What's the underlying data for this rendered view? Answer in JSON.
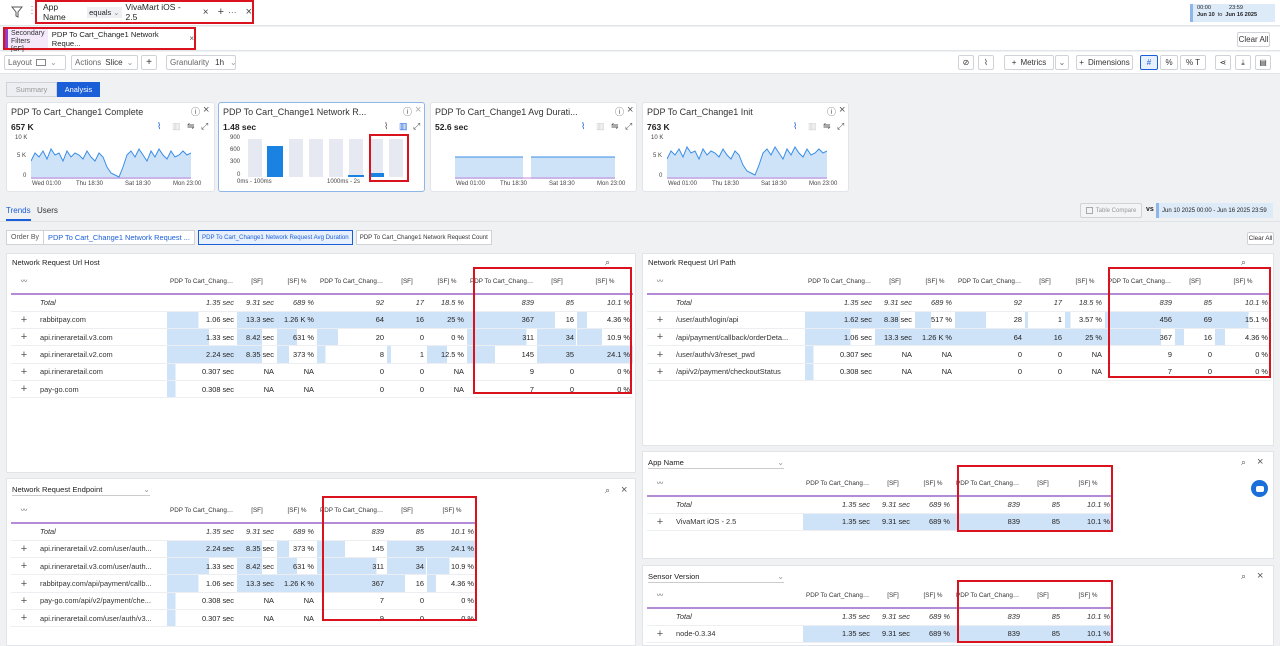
{
  "filterbar": {
    "field": "App Name",
    "operator": "equals",
    "value": "VivaMart iOS - 2.5",
    "date_from_time": "00:00",
    "date_from": "Jun 10",
    "date_to_time": "23:59",
    "date_to_label": "to",
    "date_to": "Jun 16 2025"
  },
  "secondary": {
    "label": "Secondary Filters [SF]",
    "chip": "PDP To Cart_Change1 Network Reque...",
    "clear_all": "Clear All"
  },
  "toolbar": {
    "layout": "Layout",
    "actions": "Actions",
    "slice": "Slice",
    "granularity": "Granularity",
    "granularity_value": "1h",
    "metrics": "Metrics",
    "dimensions": "Dimensions",
    "fmt_number": "#",
    "fmt_percent": "%",
    "fmt_pct_total": "% T"
  },
  "view_tabs": {
    "summary": "Summary",
    "analysis": "Analysis"
  },
  "cards": [
    {
      "title": "PDP To Cart_Change1 Complete",
      "value": "657 K",
      "y_top": "10 K",
      "y_mid": "5 K",
      "y_bot": "0",
      "x": [
        "Wed 01:00",
        "Thu 18:30",
        "Sat 18:30",
        "Mon 23:00"
      ]
    },
    {
      "title": "PDP To Cart_Change1 Network R...",
      "value": "1.48 sec",
      "y_top": "900",
      "y_mid1": "600",
      "y_mid2": "300",
      "y_bot": "0",
      "x": [
        "0ms - 100ms",
        "1000ms - 2s",
        "..."
      ]
    },
    {
      "title": "PDP To Cart_Change1 Avg Durati...",
      "value": "52.6 sec",
      "x": [
        "Wed 01:00",
        "Thu 18:30",
        "Sat 18:30",
        "Mon 23:00"
      ]
    },
    {
      "title": "PDP To Cart_Change1 Init",
      "value": "763 K",
      "y_top": "10 K",
      "y_mid": "5 K",
      "y_bot": "0",
      "x": [
        "Wed 01:00",
        "Thu 18:30",
        "Sat 18:30",
        "Mon 23:00"
      ]
    }
  ],
  "subtabs": {
    "trends": "Trends",
    "users": "Users"
  },
  "compare": {
    "table_compare": "Table Compare",
    "vs": "vs",
    "range": "Jun 10 2025 00:00 - Jun 16 2025 23:59"
  },
  "orderby": {
    "label": "Order By",
    "value": "PDP To Cart_Change1 Network Request ...",
    "chip1": "PDP To Cart_Change1 Network Request Avg Duration",
    "chip2": "PDP To Cart_Change1 Network Request Count",
    "clear_all": "Clear All"
  },
  "headers": {
    "avg": "PDP To Cart_Change1 Network Request Avg Duration",
    "sf": "[SF]",
    "sfp": "[SF] %",
    "fail": "PDP To Cart_Change1 Network Request Failure",
    "count": "PDP To Cart_Change1 Network Request Count"
  },
  "host": {
    "title": "Network Request Url Host",
    "rows": [
      {
        "name": "Total",
        "avg": "1.35 sec",
        "sf": "9.31 sec",
        "sfp": "689 %",
        "fail": "92",
        "fsf": "17",
        "fsfp": "18.5 %",
        "cnt": "839",
        "csf": "85",
        "csfp": "10.1 %"
      },
      {
        "name": "rabbitpay.com",
        "avg": "1.06 sec",
        "sf": "13.3 sec",
        "sfp": "1.26 K %",
        "fail": "64",
        "fsf": "16",
        "fsfp": "25 %",
        "cnt": "367",
        "csf": "16",
        "csfp": "4.36 %"
      },
      {
        "name": "api.rineraretail.v3.com",
        "avg": "1.33 sec",
        "sf": "8.42 sec",
        "sfp": "631 %",
        "fail": "20",
        "fsf": "0",
        "fsfp": "0 %",
        "cnt": "311",
        "csf": "34",
        "csfp": "10.9 %"
      },
      {
        "name": "api.rineraretail.v2.com",
        "avg": "2.24 sec",
        "sf": "8.35 sec",
        "sfp": "373 %",
        "fail": "8",
        "fsf": "1",
        "fsfp": "12.5 %",
        "cnt": "145",
        "csf": "35",
        "csfp": "24.1 %"
      },
      {
        "name": "api.rineraretail.com",
        "avg": "0.307 sec",
        "sf": "NA",
        "sfp": "NA",
        "fail": "0",
        "fsf": "0",
        "fsfp": "NA",
        "cnt": "9",
        "csf": "0",
        "csfp": "0 %"
      },
      {
        "name": "pay-go.com",
        "avg": "0.308 sec",
        "sf": "NA",
        "sfp": "NA",
        "fail": "0",
        "fsf": "0",
        "fsfp": "NA",
        "cnt": "7",
        "csf": "0",
        "csfp": "0 %"
      }
    ]
  },
  "path": {
    "title": "Network Request Url Path",
    "rows": [
      {
        "name": "Total",
        "avg": "1.35 sec",
        "sf": "9.31 sec",
        "sfp": "689 %",
        "fail": "92",
        "fsf": "17",
        "fsfp": "18.5 %",
        "cnt": "839",
        "csf": "85",
        "csfp": "10.1 %"
      },
      {
        "name": "/user/auth/login/api",
        "avg": "1.62 sec",
        "sf": "8.38 sec",
        "sfp": "517 %",
        "fail": "28",
        "fsf": "1",
        "fsfp": "3.57 %",
        "cnt": "456",
        "csf": "69",
        "csfp": "15.1 %"
      },
      {
        "name": "/api/payment/callback/orderDeta...",
        "avg": "1.06 sec",
        "sf": "13.3 sec",
        "sfp": "1.26 K %",
        "fail": "64",
        "fsf": "16",
        "fsfp": "25 %",
        "cnt": "367",
        "csf": "16",
        "csfp": "4.36 %"
      },
      {
        "name": "/user/auth/v3/reset_pwd",
        "avg": "0.307 sec",
        "sf": "NA",
        "sfp": "NA",
        "fail": "0",
        "fsf": "0",
        "fsfp": "NA",
        "cnt": "9",
        "csf": "0",
        "csfp": "0 %"
      },
      {
        "name": "/api/v2/payment/checkoutStatus",
        "avg": "0.308 sec",
        "sf": "NA",
        "sfp": "NA",
        "fail": "0",
        "fsf": "0",
        "fsfp": "NA",
        "cnt": "7",
        "csf": "0",
        "csfp": "0 %"
      }
    ]
  },
  "endpoint": {
    "title": "Network Request Endpoint",
    "rows": [
      {
        "name": "Total",
        "avg": "1.35 sec",
        "sf": "9.31 sec",
        "sfp": "689 %",
        "cnt": "839",
        "csf": "85",
        "csfp": "10.1 %"
      },
      {
        "name": "api.rineraretail.v2.com/user/auth...",
        "avg": "2.24 sec",
        "sf": "8.35 sec",
        "sfp": "373 %",
        "cnt": "145",
        "csf": "35",
        "csfp": "24.1 %"
      },
      {
        "name": "api.rineraretail.v3.com/user/auth...",
        "avg": "1.33 sec",
        "sf": "8.42 sec",
        "sfp": "631 %",
        "cnt": "311",
        "csf": "34",
        "csfp": "10.9 %"
      },
      {
        "name": "rabbitpay.com/api/payment/callb...",
        "avg": "1.06 sec",
        "sf": "13.3 sec",
        "sfp": "1.26 K %",
        "cnt": "367",
        "csf": "16",
        "csfp": "4.36 %"
      },
      {
        "name": "pay-go.com/api/v2/payment/che...",
        "avg": "0.308 sec",
        "sf": "NA",
        "sfp": "NA",
        "cnt": "7",
        "csf": "0",
        "csfp": "0 %"
      },
      {
        "name": "api.rineraretail.com/user/auth/v3...",
        "avg": "0.307 sec",
        "sf": "NA",
        "sfp": "NA",
        "cnt": "9",
        "csf": "0",
        "csfp": "0 %"
      }
    ]
  },
  "appname": {
    "title": "App Name",
    "rows": [
      {
        "name": "Total",
        "avg": "1.35 sec",
        "sf": "9.31 sec",
        "sfp": "689 %",
        "cnt": "839",
        "csf": "85",
        "csfp": "10.1 %"
      },
      {
        "name": "VivaMart iOS - 2.5",
        "avg": "1.35 sec",
        "sf": "9.31 sec",
        "sfp": "689 %",
        "cnt": "839",
        "csf": "85",
        "csfp": "10.1 %"
      }
    ]
  },
  "sensor": {
    "title": "Sensor Version",
    "rows": [
      {
        "name": "Total",
        "avg": "1.35 sec",
        "sf": "9.31 sec",
        "sfp": "689 %",
        "cnt": "839",
        "csf": "85",
        "csfp": "10.1 %"
      },
      {
        "name": "node-0.3.34",
        "avg": "1.35 sec",
        "sf": "9.31 sec",
        "sfp": "689 %",
        "cnt": "839",
        "csf": "85",
        "csfp": "10.1 %"
      }
    ]
  },
  "colors": {
    "accent": "#1a5fd8",
    "highlight_red": "#d9121e",
    "bar_blue": "#cfe3f8",
    "underline_purple": "#b48bd6"
  }
}
